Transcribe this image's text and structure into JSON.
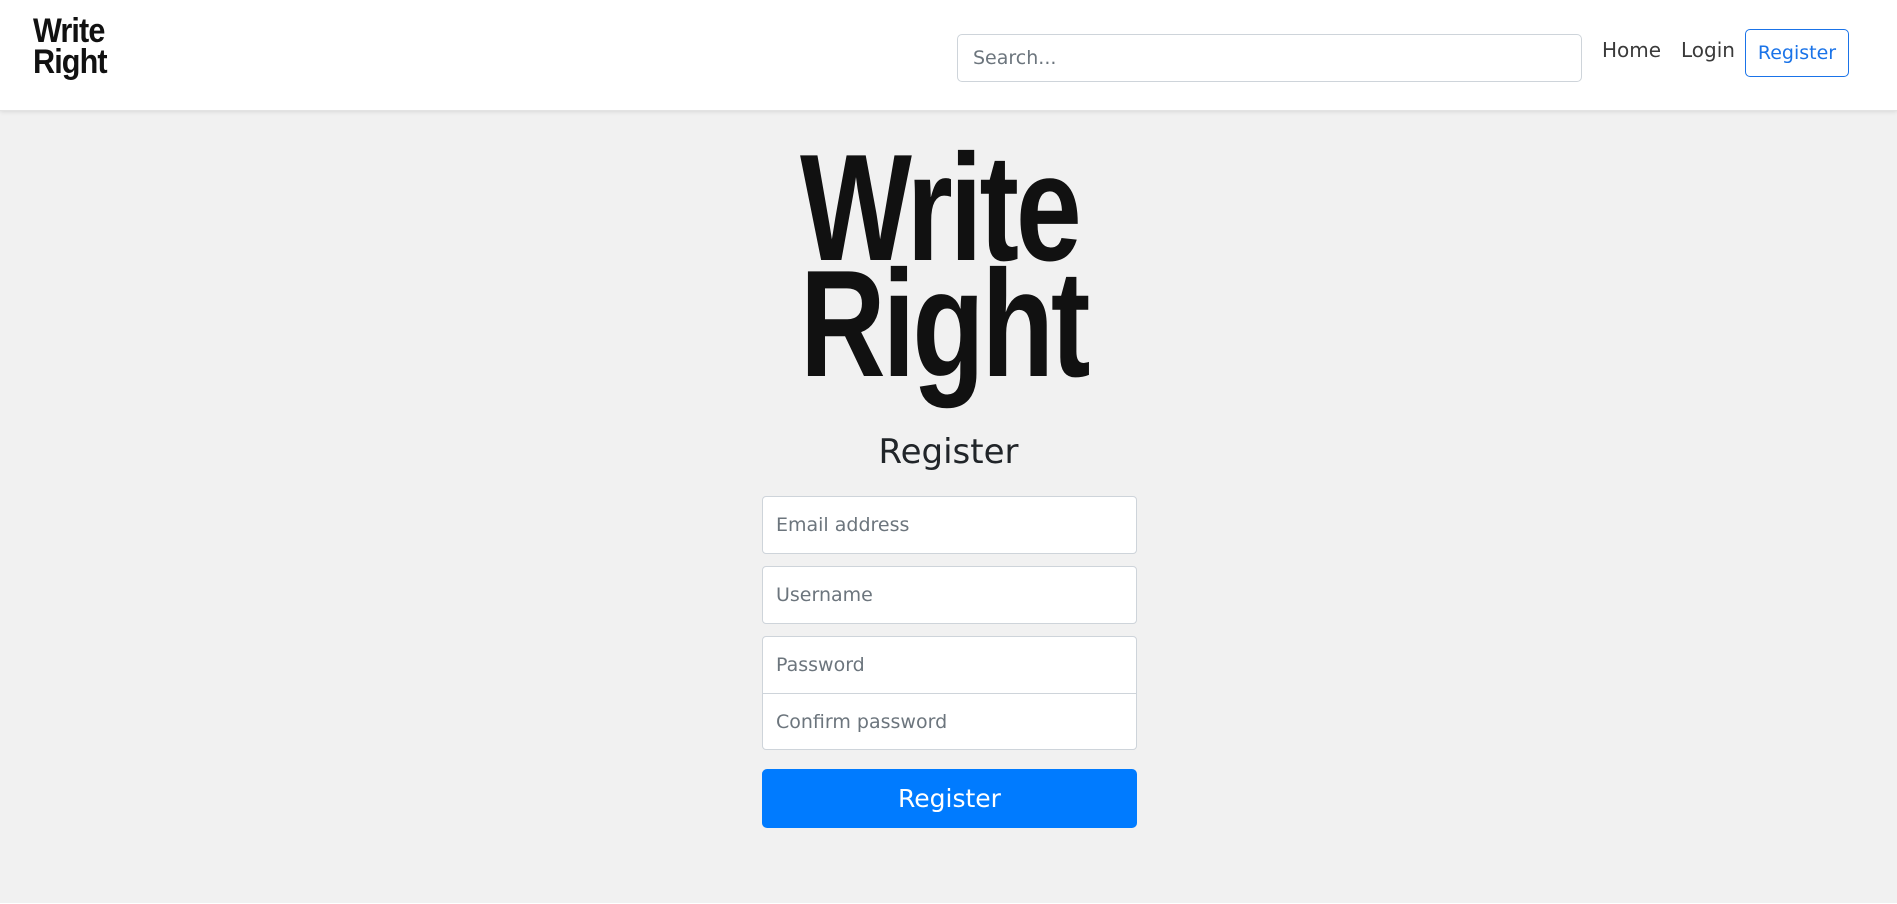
{
  "navbar": {
    "logo_line1": "Write",
    "logo_line2": "Right",
    "search_placeholder": "Search...",
    "home_label": "Home",
    "login_label": "Login",
    "register_label": "Register"
  },
  "main": {
    "logo_line1": "Write",
    "logo_line2": "Right",
    "title": "Register",
    "email_placeholder": "Email address",
    "username_placeholder": "Username",
    "password_placeholder": "Password",
    "confirm_placeholder": "Confirm password",
    "submit_label": "Register"
  },
  "colors": {
    "accent": "#007bff",
    "nav_register_border": "#1a73e8",
    "background": "#f1f1f1"
  }
}
